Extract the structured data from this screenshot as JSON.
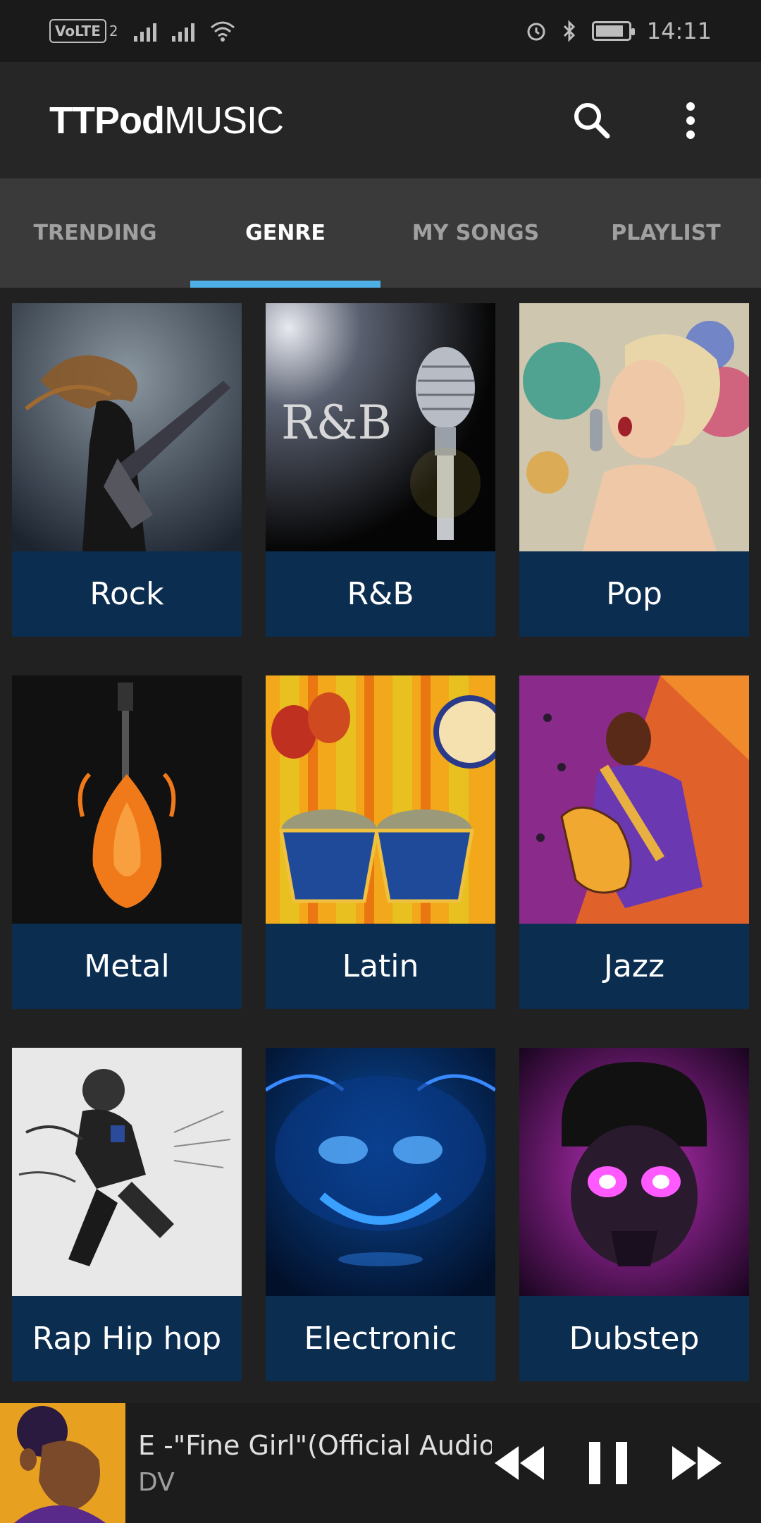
{
  "status_bar": {
    "volte": "VoLTE",
    "sim": "2",
    "time": "14:11"
  },
  "app": {
    "logo_bold": "TTPod",
    "logo_light": "MUSIC",
    "icons": [
      "search-icon",
      "more-vert-icon"
    ]
  },
  "tabs": [
    {
      "label": "TRENDING",
      "active": false
    },
    {
      "label": "GENRE",
      "active": true
    },
    {
      "label": "MY SONGS",
      "active": false
    },
    {
      "label": "PLAYLIST",
      "active": false
    }
  ],
  "genres": [
    {
      "label": "Rock"
    },
    {
      "label": "R&B",
      "art_text": "R&B"
    },
    {
      "label": "Pop"
    },
    {
      "label": "Metal"
    },
    {
      "label": "Latin"
    },
    {
      "label": "Jazz"
    },
    {
      "label": "Rap Hip hop"
    },
    {
      "label": "Electronic"
    },
    {
      "label": "Dubstep"
    }
  ],
  "now_playing": {
    "title": "E -\"Fine Girl\"(Official Audio)",
    "artist": "DV"
  },
  "colors": {
    "background": "#212121",
    "tab_bar": "#3a3a3a",
    "tab_indicator": "#4fb0e8",
    "card_label_bg": "#0b2d50"
  }
}
